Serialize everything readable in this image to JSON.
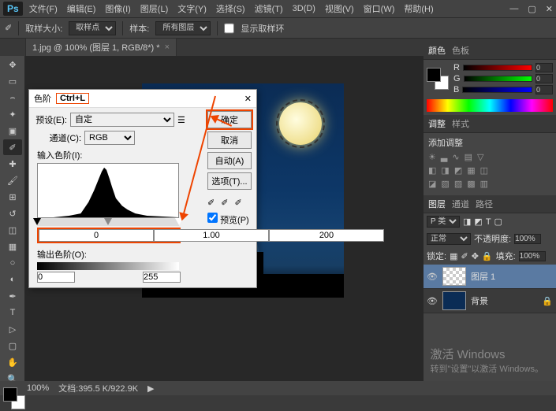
{
  "menu": {
    "file": "文件(F)",
    "edit": "编辑(E)",
    "image": "图像(I)",
    "layer": "图层(L)",
    "type": "文字(Y)",
    "select": "选择(S)",
    "filter": "滤镜(T)",
    "threed": "3D(D)",
    "view": "视图(V)",
    "window": "窗口(W)",
    "help": "帮助(H)"
  },
  "optbar": {
    "label1": "取样大小:",
    "sampling": "取样点",
    "label2": "样本:",
    "sample": "所有图层",
    "show": "显示取样环"
  },
  "tab": {
    "name": "1.jpg @ 100% (图层 1, RGB/8*) *"
  },
  "panels": {
    "color": {
      "tab1": "颜色",
      "tab2": "色板",
      "r": "R",
      "g": "G",
      "b": "B",
      "rv": "0",
      "gv": "0",
      "bv": "0"
    },
    "adj": {
      "tab1": "调整",
      "tab2": "样式",
      "label": "添加调整"
    },
    "layers": {
      "tab1": "图层",
      "tab2": "通道",
      "tab3": "路径",
      "kind": "P 类型",
      "mode": "正常",
      "opacity_lbl": "不透明度:",
      "opacity": "100%",
      "lock_lbl": "锁定:",
      "fill_lbl": "填充:",
      "fill": "100%",
      "l1": "图层 1",
      "l2": "背景"
    }
  },
  "dialog": {
    "title": "色阶",
    "shortcut": "Ctrl+L",
    "preset_lbl": "预设(E):",
    "preset": "自定",
    "channel_lbl": "通道(C):",
    "channel": "RGB",
    "input_lbl": "输入色阶(I):",
    "shadow": "0",
    "mid": "1.00",
    "highlight": "200",
    "output_lbl": "输出色阶(O):",
    "out_lo": "0",
    "out_hi": "255",
    "ok": "确定",
    "cancel": "取消",
    "auto": "自动(A)",
    "options": "选项(T)...",
    "preview": "预览(P)"
  },
  "status": {
    "zoom": "100%",
    "doc": "文档:395.5 K/922.9K"
  },
  "watermark": {
    "l1": "激活 Windows",
    "l2": "转到\"设置\"以激活 Windows。"
  }
}
